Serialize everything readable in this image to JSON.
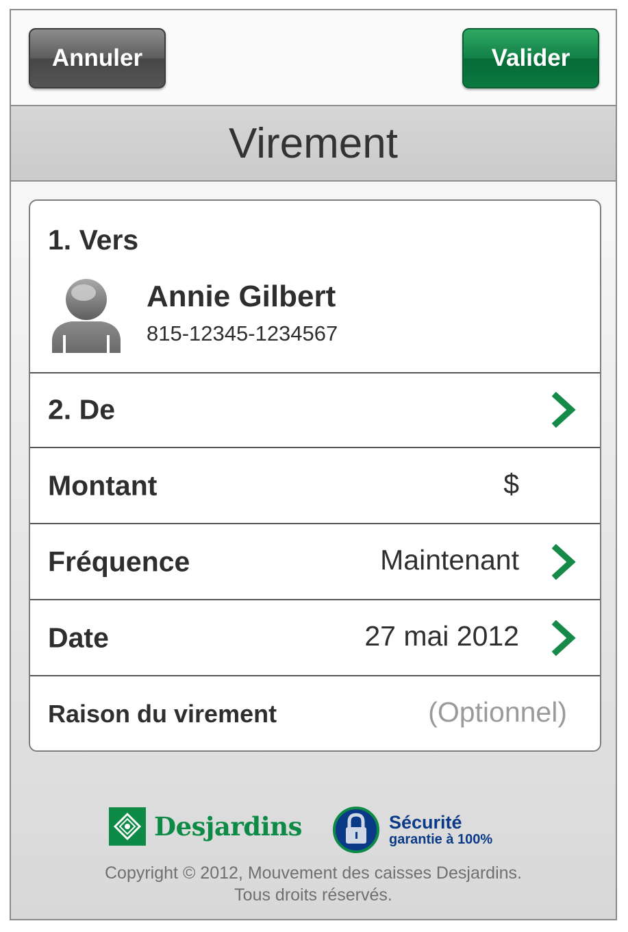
{
  "toolbar": {
    "cancel_label": "Annuler",
    "validate_label": "Valider"
  },
  "title": "Virement",
  "form": {
    "to": {
      "label": "1. Vers",
      "recipient_name": "Annie Gilbert",
      "recipient_account": "815-12345-1234567"
    },
    "from": {
      "label": "2. De"
    },
    "amount": {
      "label": "Montant",
      "value": "$"
    },
    "frequency": {
      "label": "Fréquence",
      "value": "Maintenant"
    },
    "date": {
      "label": "Date",
      "value": "27 mai 2012"
    },
    "reason": {
      "label": "Raison du virement",
      "placeholder": "(Optionnel)"
    }
  },
  "footer": {
    "brand": "Desjardins",
    "security_title": "Sécurité",
    "security_subtitle": "garantie à 100%",
    "copyright_line1": "Copyright © 2012, Mouvement des caisses Desjardins.",
    "copyright_line2": "Tous droits réservés."
  },
  "colors": {
    "accent_green": "#0d8a45",
    "chevron_green": "#168a48",
    "security_blue": "#0a3a87"
  }
}
